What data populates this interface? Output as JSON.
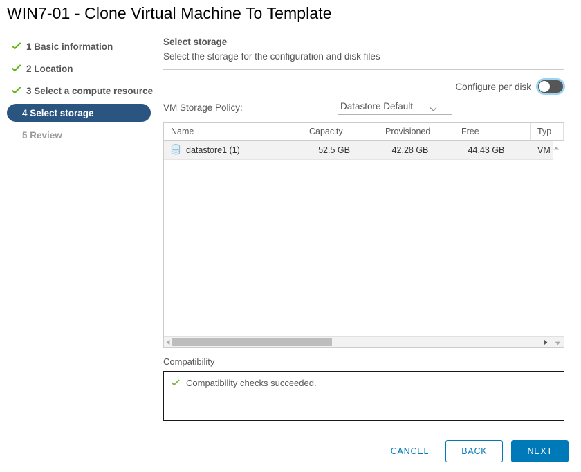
{
  "window": {
    "title": "WIN7-01 - Clone Virtual Machine To Template"
  },
  "steps": [
    {
      "label": "1 Basic information",
      "state": "done"
    },
    {
      "label": "2 Location",
      "state": "done"
    },
    {
      "label": "3 Select a compute resource",
      "state": "done"
    },
    {
      "label": "4 Select storage",
      "state": "active"
    },
    {
      "label": "5 Review",
      "state": "todo"
    }
  ],
  "section": {
    "title": "Select storage",
    "subtitle": "Select the storage for the configuration and disk files"
  },
  "configure_per_disk": {
    "label": "Configure per disk",
    "state": "off"
  },
  "storage_policy": {
    "label": "VM Storage Policy:",
    "value": "Datastore Default",
    "options": [
      "Datastore Default"
    ]
  },
  "table": {
    "columns": [
      "Name",
      "Capacity",
      "Provisioned",
      "Free",
      "Typ"
    ],
    "rows": [
      {
        "icon": "datastore-icon",
        "name": "datastore1 (1)",
        "capacity": "52.5 GB",
        "provisioned": "42.28 GB",
        "free": "44.43 GB",
        "type": "VM"
      }
    ]
  },
  "compatibility": {
    "label": "Compatibility",
    "message": "Compatibility checks succeeded."
  },
  "footer": {
    "cancel": "CANCEL",
    "back": "BACK",
    "next": "NEXT"
  },
  "colors": {
    "accent_blue": "#0079b8",
    "active_step": "#2a5580",
    "success_green": "#60b515"
  }
}
